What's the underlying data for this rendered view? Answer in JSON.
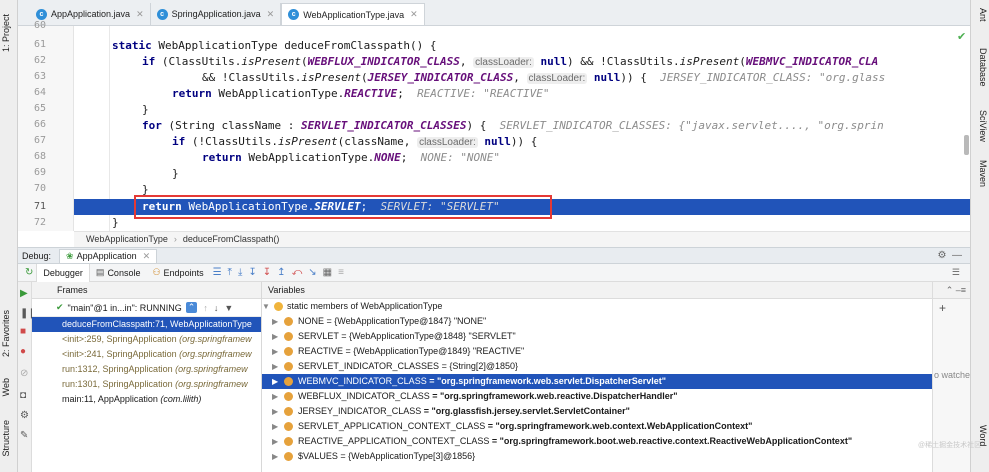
{
  "left_strip": {
    "project": "1: Project",
    "favorites": "2: Favorites",
    "web": "Web",
    "structure": "Structure"
  },
  "right_strip": {
    "ant": "Ant",
    "database": "Database",
    "sciview": "SciView",
    "maven": "Maven",
    "word": "Word"
  },
  "tabs": [
    {
      "label": "AppApplication.java",
      "icon": "class-icon"
    },
    {
      "label": "SpringApplication.java",
      "icon": "class-icon"
    },
    {
      "label": "WebApplicationType.java",
      "icon": "class-icon",
      "active": true
    }
  ],
  "editor": {
    "line_numbers": [
      "60",
      "61",
      "62",
      "63",
      "64",
      "65",
      "66",
      "67",
      "68",
      "69",
      "70",
      "71",
      "72"
    ],
    "lines": {
      "l61_a": "static ",
      "l61_b": "WebApplicationType deduceFromClasspath() {",
      "l62_a": "if ",
      "l62_b": "(ClassUtils.",
      "l62_c": "isPresent",
      "l62_d": "(",
      "l62_e": "WEBFLUX_INDICATOR_CLASS",
      "l62_f": ", ",
      "l62_hint": "classLoader:",
      "l62_g": " null",
      "l62_h": ") && !ClassUtils.",
      "l62_i": "isPresent",
      "l62_j": "(",
      "l62_k": "WEBMVC_INDICATOR_CLA",
      "l63_a": "&& !ClassUtils.",
      "l63_b": "isPresent",
      "l63_c": "(",
      "l63_d": "JERSEY_INDICATOR_CLASS",
      "l63_e": ", ",
      "l63_hint": "classLoader:",
      "l63_f": " null",
      "l63_g": ")) {  ",
      "l63_dbg": "JERSEY_INDICATOR_CLASS: \"org.glass",
      "l64_a": "return ",
      "l64_b": "WebApplicationType.",
      "l64_c": "REACTIVE",
      "l64_d": ";  ",
      "l64_dbg": "REACTIVE: \"REACTIVE\"",
      "l65": "}",
      "l66_a": "for ",
      "l66_b": "(String className : ",
      "l66_c": "SERVLET_INDICATOR_CLASSES",
      "l66_d": ") {  ",
      "l66_dbg": "SERVLET_INDICATOR_CLASSES: {\"javax.servlet...., \"org.sprin",
      "l67_a": "if ",
      "l67_b": "(!ClassUtils.",
      "l67_c": "isPresent",
      "l67_d": "(className, ",
      "l67_hint": "classLoader:",
      "l67_e": " null",
      "l67_f": ")) {",
      "l68_a": "return ",
      "l68_b": "WebApplicationType.",
      "l68_c": "NONE",
      "l68_d": ";  ",
      "l68_dbg": "NONE: \"NONE\"",
      "l69": "}",
      "l70": "}",
      "l71_a": "return ",
      "l71_b": "WebApplicationType.",
      "l71_c": "SERVLET",
      "l71_d": ";  ",
      "l71_dbg": "SERVLET: \"SERVLET\"",
      "l72": "}"
    }
  },
  "breadcrumb": {
    "class": "WebApplicationType",
    "method": "deduceFromClasspath()"
  },
  "debug": {
    "label": "Debug:",
    "run_config": "AppApplication",
    "tabs": {
      "debugger": "Debugger",
      "console": "Console",
      "endpoints": "Endpoints"
    }
  },
  "frames": {
    "header": "Frames",
    "thread": "\"main\"@1 in...in\": RUNNING",
    "items": [
      {
        "method": "deduceFromClasspath:71, WebApplicationType",
        "cls": ""
      },
      {
        "method": "<init>:259, SpringApplication ",
        "cls": "(org.springframew"
      },
      {
        "method": "<init>:241, SpringApplication ",
        "cls": "(org.springframew"
      },
      {
        "method": "run:1312, SpringApplication ",
        "cls": "(org.springframew"
      },
      {
        "method": "run:1301, SpringApplication ",
        "cls": "(org.springframew"
      },
      {
        "method": "main:11, AppApplication ",
        "cls": "(com.lilith)"
      }
    ]
  },
  "variables": {
    "header": "Variables",
    "rows": [
      {
        "name": "static",
        "value": " members of WebApplicationType"
      },
      {
        "name": "NONE",
        "value": " = {WebApplicationType@1847} \"NONE\""
      },
      {
        "name": "SERVLET",
        "value": " = {WebApplicationType@1848} \"SERVLET\""
      },
      {
        "name": "REACTIVE",
        "value": " = {WebApplicationType@1849} \"REACTIVE\""
      },
      {
        "name": "SERVLET_INDICATOR_CLASSES",
        "value": " = {String[2]@1850}"
      },
      {
        "name": "WEBMVC_INDICATOR_CLASS",
        "value": " = \"org.springframework.web.servlet.DispatcherServlet\""
      },
      {
        "name": "WEBFLUX_INDICATOR_CLASS",
        "value": " = \"org.springframework.web.reactive.DispatcherHandler\""
      },
      {
        "name": "JERSEY_INDICATOR_CLASS",
        "value": " = \"org.glassfish.jersey.servlet.ServletContainer\""
      },
      {
        "name": "SERVLET_APPLICATION_CONTEXT_CLASS",
        "value": " = \"org.springframework.web.context.WebApplicationContext\""
      },
      {
        "name": "REACTIVE_APPLICATION_CONTEXT_CLASS",
        "value": " = \"org.springframework.boot.web.reactive.context.ReactiveWebApplicationContext\""
      },
      {
        "name": "$VALUES",
        "value": " = {WebApplicationType[3]@1856}"
      }
    ]
  },
  "watches": {
    "text": "o watche"
  },
  "watermark": "@稀土掘金技术社区"
}
